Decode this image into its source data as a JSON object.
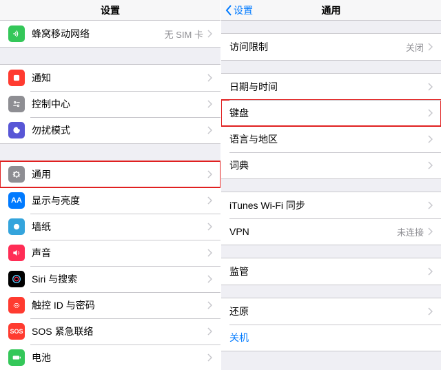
{
  "left": {
    "title": "设置",
    "rows": {
      "cellular": {
        "label": "蜂窝移动网络",
        "value": "无 SIM 卡"
      },
      "notif": {
        "label": "通知"
      },
      "control": {
        "label": "控制中心"
      },
      "dnd": {
        "label": "勿扰模式"
      },
      "general": {
        "label": "通用"
      },
      "display": {
        "label": "显示与亮度"
      },
      "wallpaper": {
        "label": "墙纸"
      },
      "sound": {
        "label": "声音"
      },
      "siri": {
        "label": "Siri 与搜索"
      },
      "touchid": {
        "label": "触控 ID 与密码"
      },
      "sos": {
        "label": "SOS 紧急联络"
      },
      "battery": {
        "label": "电池"
      }
    }
  },
  "right": {
    "back": "设置",
    "title": "通用",
    "rows": {
      "restrictions": {
        "label": "访问限制",
        "value": "关闭"
      },
      "datetime": {
        "label": "日期与时间"
      },
      "keyboard": {
        "label": "键盘"
      },
      "lang": {
        "label": "语言与地区"
      },
      "dict": {
        "label": "词典"
      },
      "itunes": {
        "label": "iTunes Wi-Fi 同步"
      },
      "vpn": {
        "label": "VPN",
        "value": "未连接"
      },
      "supervision": {
        "label": "监管"
      },
      "reset": {
        "label": "还原"
      },
      "shutdown": {
        "label": "关机"
      }
    }
  }
}
